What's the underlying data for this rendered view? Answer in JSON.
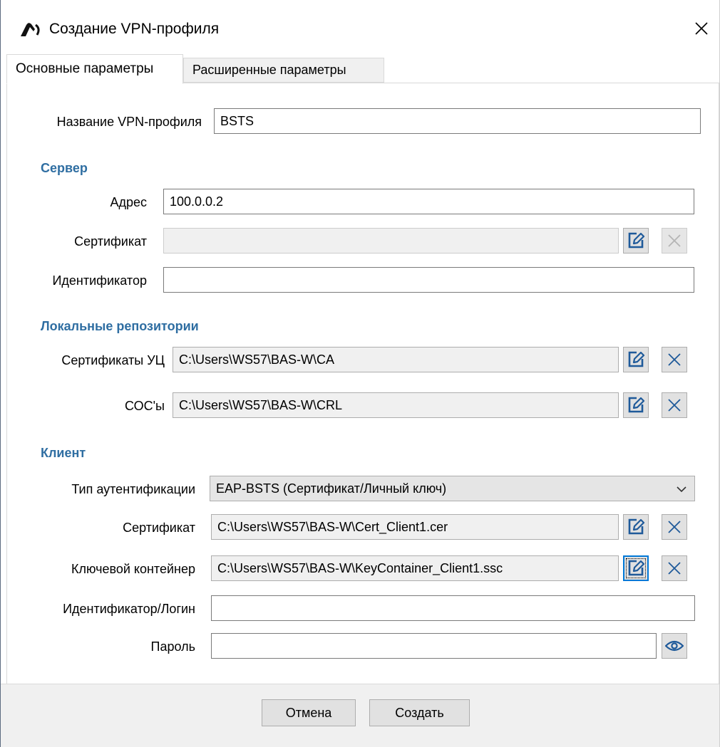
{
  "window": {
    "title": "Создание VPN-профиля"
  },
  "tabs": [
    {
      "label": "Основные параметры",
      "active": true
    },
    {
      "label": "Расширенные параметры",
      "active": false
    }
  ],
  "profile": {
    "name_label": "Название VPN-профиля",
    "name_value": "BSTS"
  },
  "server": {
    "heading": "Сервер",
    "address_label": "Адрес",
    "address_value": "100.0.0.2",
    "cert_label": "Сертификат",
    "cert_value": "",
    "id_label": "Идентификатор",
    "id_value": ""
  },
  "repos": {
    "heading": "Локальные репозитории",
    "ca_label": "Сертификаты УЦ",
    "ca_value": "C:\\Users\\WS57\\BAS-W\\CA",
    "crl_label": "СОС'ы",
    "crl_value": "C:\\Users\\WS57\\BAS-W\\CRL"
  },
  "client": {
    "heading": "Клиент",
    "auth_label": "Тип аутентификации",
    "auth_value": "EAP-BSTS (Сертификат/Личный ключ)",
    "cert_label": "Сертификат",
    "cert_value": "C:\\Users\\WS57\\BAS-W\\Cert_Client1.cer",
    "key_label": "Ключевой контейнер",
    "key_value": "C:\\Users\\WS57\\BAS-W\\KeyContainer_Client1.ssc",
    "login_label": "Идентификатор/Логин",
    "login_value": "",
    "password_label": "Пароль",
    "password_value": ""
  },
  "footer": {
    "cancel_label": "Отмена",
    "create_label": "Создать"
  },
  "colors": {
    "section_heading": "#2f6ea2",
    "icon_blue": "#1f5a9a",
    "focus": "#0078d7"
  },
  "icons": {
    "edit": "edit-icon",
    "clear": "clear-icon",
    "eye": "eye-icon",
    "close": "close-icon",
    "dropdown": "chevron-down-icon",
    "app": "app-logo-icon"
  }
}
